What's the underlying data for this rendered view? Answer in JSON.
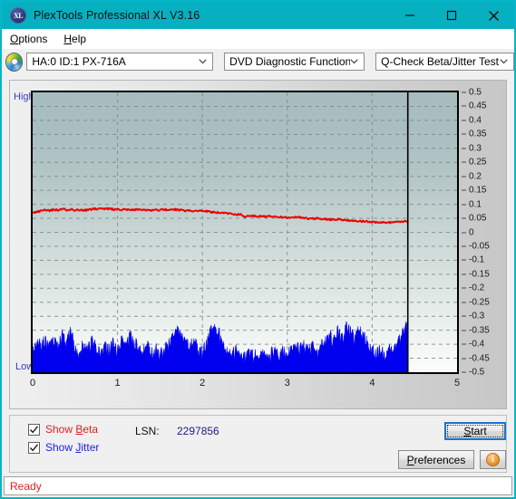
{
  "window": {
    "title": "PlexTools Professional XL V3.16",
    "app_icon": "xl-disc-icon",
    "minimize": "minimize-icon",
    "maximize": "maximize-icon",
    "close": "close-icon",
    "titlebar_color": "#06b0c0"
  },
  "menu": {
    "items": [
      {
        "label": "Options",
        "accel": "O"
      },
      {
        "label": "Help",
        "accel": "H"
      }
    ]
  },
  "toolbar": {
    "drive_icon": "optical-disc-icon",
    "drive": "HA:0 ID:1  PX-716A",
    "function": "DVD Diagnostic Functions",
    "test": "Q-Check Beta/Jitter Test"
  },
  "chart_panel": {
    "label_high": "High",
    "label_low": "Low"
  },
  "controls": {
    "show_beta": {
      "label": "Show Beta",
      "accel": "B",
      "checked": true,
      "color": "#e02020"
    },
    "show_jitter": {
      "label": "Show Jitter",
      "accel": "J",
      "checked": true,
      "color": "#2020e0"
    },
    "lsn_label": "LSN:",
    "lsn_value": "2297856",
    "start": "Start",
    "start_accel": "S",
    "preferences": "Preferences",
    "preferences_accel": "P",
    "info": "info-icon"
  },
  "statusbar": {
    "text": "Ready"
  },
  "chart_data": {
    "type": "line",
    "title": "Q-Check Beta/Jitter Test",
    "xlabel": "",
    "ylabel": "",
    "xlim": [
      0,
      5
    ],
    "ylim": [
      -0.5,
      0.5
    ],
    "xticks": [
      0,
      1,
      2,
      3,
      4,
      5
    ],
    "yticks": [
      0.5,
      0.45,
      0.4,
      0.35,
      0.3,
      0.25,
      0.2,
      0.15,
      0.1,
      0.05,
      0,
      -0.05,
      -0.1,
      -0.15,
      -0.2,
      -0.25,
      -0.3,
      -0.35,
      -0.4,
      -0.45,
      -0.5
    ],
    "ytick_labels": [
      "0.5",
      "0.45",
      "0.4",
      "0.35",
      "0.3",
      "0.25",
      "0.2",
      "0.15",
      "0.1",
      "0.05",
      "0",
      "-0.05",
      "-0.1",
      "-0.15",
      "-0.2",
      "-0.25",
      "-0.3",
      "-0.35",
      "-0.4",
      "-0.45",
      "-0.5"
    ],
    "grid": true,
    "grid_style": "dashed",
    "legend": [
      "Show Beta",
      "Show Jitter"
    ],
    "legend_position": "below-left",
    "data_end_x": 4.42,
    "series": [
      {
        "name": "Beta",
        "color": "#ee0000",
        "style": "line",
        "x": [
          0.0,
          0.05,
          0.1,
          0.15,
          0.2,
          0.25,
          0.3,
          0.35,
          0.4,
          0.45,
          0.5,
          0.55,
          0.6,
          0.65,
          0.7,
          0.75,
          0.8,
          0.85,
          0.9,
          0.95,
          1.0,
          1.05,
          1.1,
          1.15,
          1.2,
          1.25,
          1.3,
          1.35,
          1.4,
          1.45,
          1.5,
          1.55,
          1.6,
          1.65,
          1.7,
          1.75,
          1.8,
          1.85,
          1.9,
          1.95,
          2.0,
          2.05,
          2.1,
          2.15,
          2.2,
          2.25,
          2.3,
          2.35,
          2.4,
          2.45,
          2.5,
          2.55,
          2.6,
          2.65,
          2.7,
          2.75,
          2.8,
          2.85,
          2.9,
          2.95,
          3.0,
          3.05,
          3.1,
          3.15,
          3.2,
          3.25,
          3.3,
          3.35,
          3.4,
          3.45,
          3.5,
          3.55,
          3.6,
          3.65,
          3.7,
          3.75,
          3.8,
          3.85,
          3.9,
          3.95,
          4.0,
          4.05,
          4.1,
          4.15,
          4.2,
          4.25,
          4.3,
          4.35,
          4.4,
          4.42
        ],
        "y": [
          0.07,
          0.073,
          0.076,
          0.08,
          0.078,
          0.081,
          0.079,
          0.083,
          0.08,
          0.082,
          0.079,
          0.081,
          0.078,
          0.08,
          0.082,
          0.084,
          0.083,
          0.085,
          0.084,
          0.082,
          0.083,
          0.081,
          0.08,
          0.082,
          0.08,
          0.081,
          0.079,
          0.08,
          0.078,
          0.079,
          0.08,
          0.081,
          0.08,
          0.082,
          0.081,
          0.079,
          0.077,
          0.078,
          0.076,
          0.075,
          0.077,
          0.075,
          0.073,
          0.072,
          0.07,
          0.069,
          0.068,
          0.066,
          0.064,
          0.063,
          0.055,
          0.057,
          0.059,
          0.058,
          0.057,
          0.056,
          0.058,
          0.057,
          0.055,
          0.054,
          0.053,
          0.052,
          0.054,
          0.053,
          0.051,
          0.05,
          0.049,
          0.05,
          0.048,
          0.047,
          0.046,
          0.045,
          0.046,
          0.044,
          0.043,
          0.042,
          0.041,
          0.04,
          0.039,
          0.038,
          0.037,
          0.036,
          0.035,
          0.034,
          0.035,
          0.036,
          0.037,
          0.038,
          0.038,
          0.038
        ]
      },
      {
        "name": "Jitter",
        "color": "#0000ee",
        "style": "area",
        "baseline": -0.5,
        "x": [
          0.0,
          0.05,
          0.1,
          0.15,
          0.2,
          0.25,
          0.3,
          0.35,
          0.4,
          0.45,
          0.5,
          0.55,
          0.6,
          0.65,
          0.7,
          0.75,
          0.8,
          0.85,
          0.9,
          0.95,
          1.0,
          1.05,
          1.1,
          1.15,
          1.2,
          1.25,
          1.3,
          1.35,
          1.4,
          1.45,
          1.5,
          1.55,
          1.6,
          1.65,
          1.7,
          1.75,
          1.8,
          1.85,
          1.9,
          1.95,
          2.0,
          2.05,
          2.1,
          2.15,
          2.2,
          2.25,
          2.3,
          2.35,
          2.4,
          2.45,
          2.5,
          2.55,
          2.6,
          2.65,
          2.7,
          2.75,
          2.8,
          2.85,
          2.9,
          2.95,
          3.0,
          3.05,
          3.1,
          3.15,
          3.2,
          3.25,
          3.3,
          3.35,
          3.4,
          3.45,
          3.5,
          3.55,
          3.6,
          3.65,
          3.7,
          3.75,
          3.8,
          3.85,
          3.9,
          3.95,
          4.0,
          4.05,
          4.1,
          4.15,
          4.2,
          4.25,
          4.3,
          4.35,
          4.4,
          4.42
        ],
        "y": [
          -0.43,
          -0.392,
          -0.4,
          -0.383,
          -0.41,
          -0.388,
          -0.415,
          -0.372,
          -0.398,
          -0.36,
          -0.415,
          -0.43,
          -0.405,
          -0.425,
          -0.39,
          -0.418,
          -0.44,
          -0.412,
          -0.428,
          -0.4,
          -0.43,
          -0.392,
          -0.404,
          -0.372,
          -0.398,
          -0.42,
          -0.434,
          -0.408,
          -0.44,
          -0.418,
          -0.445,
          -0.425,
          -0.4,
          -0.37,
          -0.344,
          -0.368,
          -0.39,
          -0.412,
          -0.398,
          -0.42,
          -0.436,
          -0.4,
          -0.352,
          -0.34,
          -0.368,
          -0.398,
          -0.422,
          -0.44,
          -0.418,
          -0.44,
          -0.448,
          -0.432,
          -0.446,
          -0.43,
          -0.442,
          -0.424,
          -0.44,
          -0.428,
          -0.442,
          -0.43,
          -0.445,
          -0.422,
          -0.4,
          -0.424,
          -0.408,
          -0.43,
          -0.416,
          -0.438,
          -0.404,
          -0.396,
          -0.372,
          -0.392,
          -0.356,
          -0.38,
          -0.34,
          -0.362,
          -0.384,
          -0.352,
          -0.374,
          -0.396,
          -0.416,
          -0.438,
          -0.42,
          -0.44,
          -0.424,
          -0.438,
          -0.4,
          -0.368,
          -0.336,
          -0.34
        ]
      }
    ]
  }
}
